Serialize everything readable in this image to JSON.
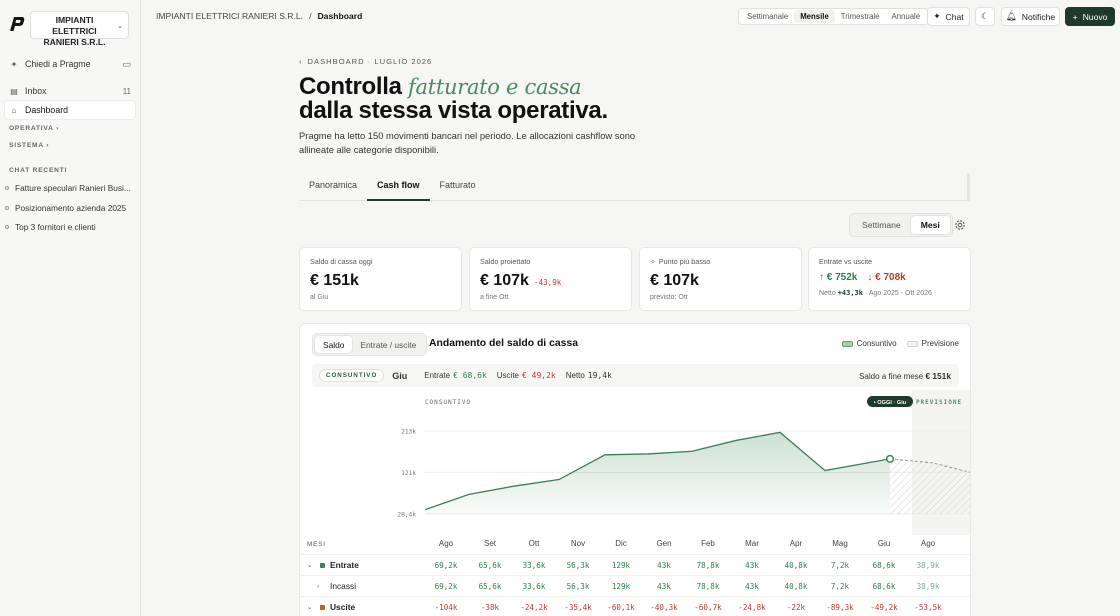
{
  "sidebar": {
    "company": "IMPIANTI ELETTRICI RANIERI S.R.L.",
    "ask": "Chiedi a Pragme",
    "inbox": "Inbox",
    "inbox_count": "11",
    "dashboard": "Dashboard",
    "sec_operativa": "OPERATIVA",
    "sec_sistema": "SISTEMA",
    "sec_chat": "CHAT RECENTI",
    "chats": [
      "Fatture speculari Ranieri Busi...",
      "Posizionamento azienda 2025",
      "Top 3 fornitori e clienti"
    ]
  },
  "topbar": {
    "crumb_company": "IMPIANTI ELETTRICI RANIERI S.R.L.",
    "crumb_sep": "/",
    "crumb_page": "Dashboard",
    "periods": [
      "Settimanale",
      "Mensile",
      "Trimestrale",
      "Annuale"
    ],
    "chat": "Chat",
    "notifications": "Notifiche",
    "new": "Nuovo"
  },
  "hero": {
    "eyebrow": "DASHBOARD · LUGLIO 2026",
    "title_1": "Controlla",
    "title_italic": "fatturato e cassa",
    "title_2": "dalla stessa vista operativa.",
    "lead": "Pragme ha letto 150 movimenti bancari nel periodo. Le allocazioni cashflow sono allineate alle categorie disponibili."
  },
  "tabs": [
    "Panoramica",
    "Cash flow",
    "Fatturato"
  ],
  "granularity": [
    "Settimane",
    "Mesi"
  ],
  "kpis": {
    "cash_label": "Saldo di cassa oggi",
    "cash_value": "€ 151k",
    "cash_sub": "al Giu",
    "proj_label": "Saldo proiettato",
    "proj_value": "€ 107k",
    "proj_delta": "-43,9k",
    "proj_sub": "a fine Ott",
    "low_label": "Punto più basso",
    "low_value": "€ 107k",
    "low_sub": "previsto: Ott",
    "io_label": "Entrate vs uscite",
    "io_in": "€ 752k",
    "io_out": "€ 708k",
    "io_net_label": "Netto",
    "io_net": "+43,3k",
    "io_range": "Ago 2025 - Ott 2026"
  },
  "chart_card": {
    "seg": [
      "Saldo",
      "Entrate / uscite"
    ],
    "title": "Andamento del saldo di cassa",
    "legend_actual": "Consuntivo",
    "legend_forecast": "Previsione",
    "strip_pill": "CONSUNTIVO",
    "strip_month": "Giu",
    "strip_in_label": "Entrate",
    "strip_in": "€ 68,6k",
    "strip_out_label": "Uscite",
    "strip_out": "€ 49,2k",
    "strip_net_label": "Netto",
    "strip_net": "19,4k",
    "strip_end_label": "Saldo a fine mese",
    "strip_end": "€ 151k"
  },
  "colors": {
    "accent": "#1f3a2c",
    "line": "#3c7d5a",
    "positive": "#2e7d4f",
    "negative": "#c0392b"
  },
  "chart_data": {
    "type": "area",
    "x": [
      "Ago",
      "Set",
      "Ott",
      "Nov",
      "Dic",
      "Gen",
      "Feb",
      "Mar",
      "Apr",
      "Mag",
      "Giu",
      "Ago",
      "Set"
    ],
    "y_ticks": [
      "213k",
      "121k",
      "28,4k"
    ],
    "ylim": [
      28.4,
      213
    ],
    "series": [
      {
        "name": "Consuntivo",
        "values": [
          38,
          72,
          90,
          105,
          160,
          162,
          168,
          192,
          210,
          125,
          151
        ]
      },
      {
        "name": "Previsione",
        "values": [
          151,
          142,
          120
        ]
      }
    ],
    "forecast_start_index": 10,
    "marker_label": "• OGGI · Giu",
    "region_actual": "CONSUNTIVO",
    "region_forecast": "PREVISIONE"
  },
  "table": {
    "head_label": "MESI",
    "months": [
      "Ago",
      "Set",
      "Ott",
      "Nov",
      "Dic",
      "Gen",
      "Feb",
      "Mar",
      "Apr",
      "Mag",
      "Giu",
      "Ago"
    ],
    "rows": [
      {
        "label": "Entrate",
        "values": [
          "69,2k",
          "65,6k",
          "33,6k",
          "56,3k",
          "129k",
          "43k",
          "78,8k",
          "43k",
          "40,8k",
          "7,2k",
          "68,6k",
          "38,9k"
        ]
      },
      {
        "label": "Incassi",
        "values": [
          "69,2k",
          "65,6k",
          "33,6k",
          "56,3k",
          "129k",
          "43k",
          "78,8k",
          "43k",
          "40,8k",
          "7,2k",
          "68,6k",
          "38,9k"
        ]
      },
      {
        "label": "Uscite",
        "values": [
          "-104k",
          "-38k",
          "-24,2k",
          "-35,4k",
          "-60,1k",
          "-40,3k",
          "-60,7k",
          "-24,8k",
          "-22k",
          "-89,3k",
          "-49,2k",
          "-53,5k"
        ]
      }
    ]
  }
}
